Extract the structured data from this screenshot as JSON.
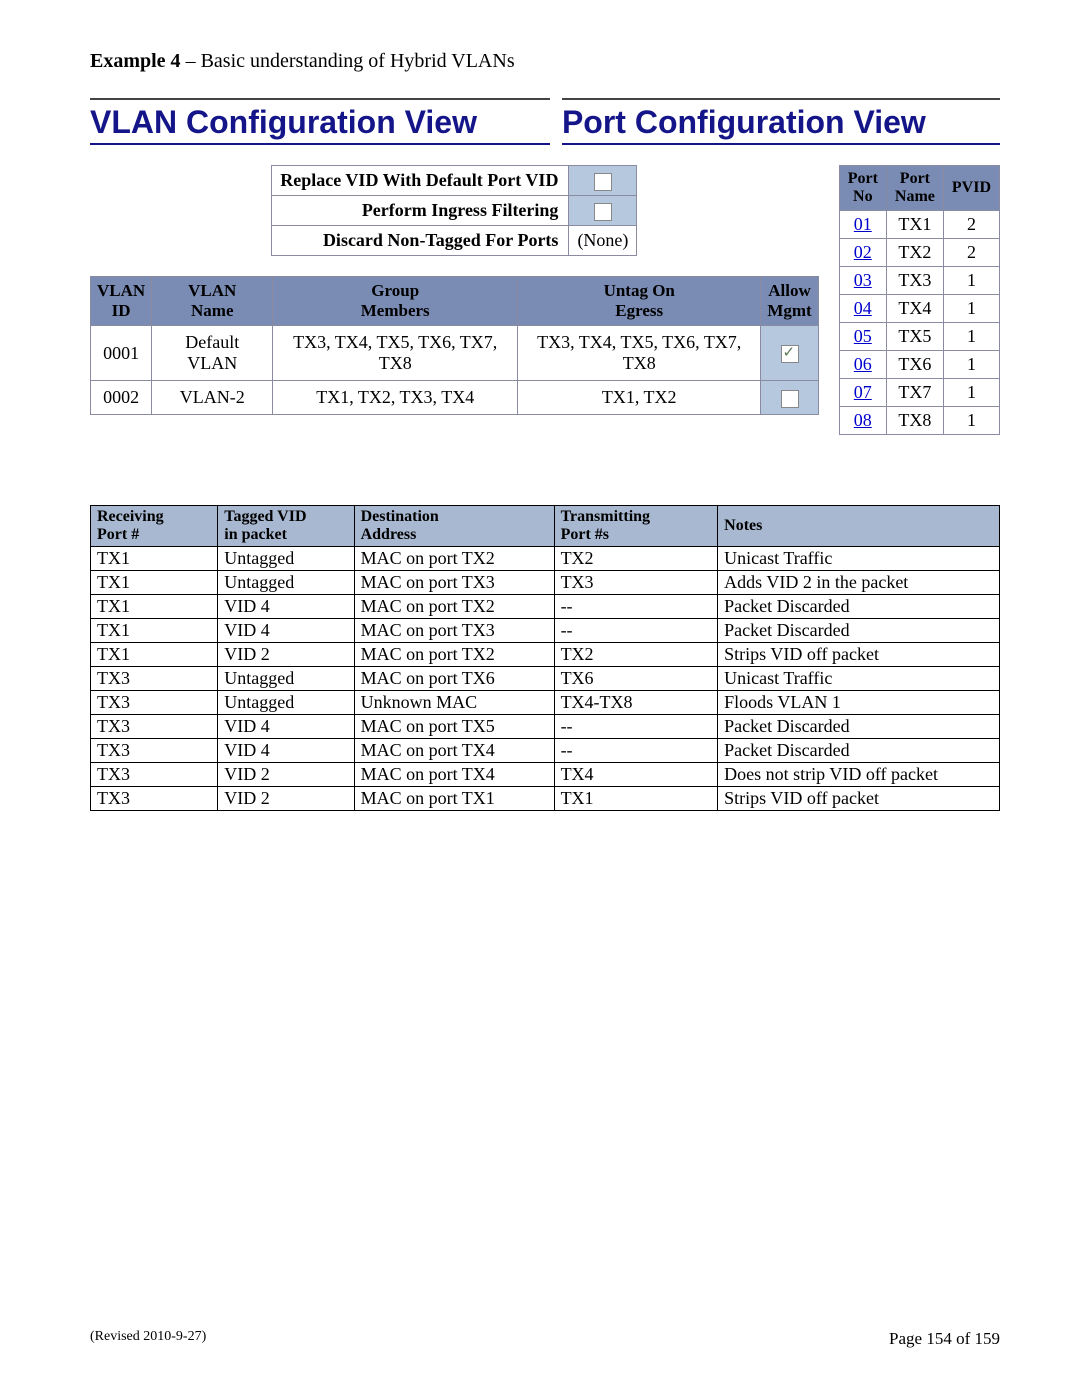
{
  "example": {
    "label": "Example 4",
    "desc": " – Basic understanding of Hybrid VLANs"
  },
  "headings": {
    "vlan": "VLAN Configuration View",
    "port": "Port Configuration View"
  },
  "settings": [
    {
      "label": "Replace VID With Default Port VID",
      "type": "checkbox",
      "checked": false
    },
    {
      "label": "Perform Ingress Filtering",
      "type": "checkbox",
      "checked": false
    },
    {
      "label": "Discard Non-Tagged For Ports",
      "type": "text",
      "value": "(None)"
    }
  ],
  "vlan_table": {
    "headers": [
      "VLAN\nID",
      "VLAN\nName",
      "Group\nMembers",
      "Untag On\nEgress",
      "Allow\nMgmt"
    ],
    "rows": [
      {
        "id": "0001",
        "name": "Default VLAN",
        "members": "TX3, TX4, TX5, TX6, TX7, TX8",
        "untag": "TX3, TX4, TX5, TX6, TX7, TX8",
        "mgmt": true
      },
      {
        "id": "0002",
        "name": "VLAN-2",
        "members": "TX1, TX2, TX3, TX4",
        "untag": "TX1, TX2",
        "mgmt": false
      }
    ]
  },
  "port_table": {
    "headers": [
      "Port\nNo",
      "Port\nName",
      "PVID"
    ],
    "rows": [
      {
        "no": "01",
        "name": "TX1",
        "pvid": "2"
      },
      {
        "no": "02",
        "name": "TX2",
        "pvid": "2"
      },
      {
        "no": "03",
        "name": "TX3",
        "pvid": "1"
      },
      {
        "no": "04",
        "name": "TX4",
        "pvid": "1"
      },
      {
        "no": "05",
        "name": "TX5",
        "pvid": "1"
      },
      {
        "no": "06",
        "name": "TX6",
        "pvid": "1"
      },
      {
        "no": "07",
        "name": "TX7",
        "pvid": "1"
      },
      {
        "no": "08",
        "name": "TX8",
        "pvid": "1"
      }
    ]
  },
  "traffic_table": {
    "headers": [
      "Receiving\nPort #",
      "Tagged VID\nin packet",
      "Destination\nAddress",
      "Transmitting\nPort #s",
      "Notes"
    ],
    "rows": [
      [
        "TX1",
        "Untagged",
        "MAC on port TX2",
        "TX2",
        "Unicast Traffic"
      ],
      [
        "TX1",
        "Untagged",
        "MAC on port TX3",
        "TX3",
        "Adds VID 2 in the packet"
      ],
      [
        "TX1",
        "VID 4",
        "MAC on port TX2",
        "--",
        "Packet Discarded"
      ],
      [
        "TX1",
        "VID 4",
        "MAC on port TX3",
        "--",
        "Packet Discarded"
      ],
      [
        "TX1",
        "VID 2",
        "MAC on port TX2",
        "TX2",
        "Strips VID off packet"
      ],
      [
        "TX3",
        "Untagged",
        "MAC on port TX6",
        "TX6",
        "Unicast Traffic"
      ],
      [
        "TX3",
        "Untagged",
        "Unknown MAC",
        "TX4-TX8",
        "Floods VLAN 1"
      ],
      [
        "TX3",
        "VID 4",
        "MAC on port TX5",
        "--",
        "Packet Discarded"
      ],
      [
        "TX3",
        "VID 4",
        "MAC on port TX4",
        "--",
        "Packet Discarded"
      ],
      [
        "TX3",
        "VID 2",
        "MAC on port TX4",
        "TX4",
        "Does not strip VID off packet"
      ],
      [
        "TX3",
        "VID 2",
        "MAC on port TX1",
        "TX1",
        "Strips VID off packet"
      ]
    ]
  },
  "footer": {
    "revised": "(Revised 2010-9-27)",
    "page": "Page 154 of 159"
  }
}
